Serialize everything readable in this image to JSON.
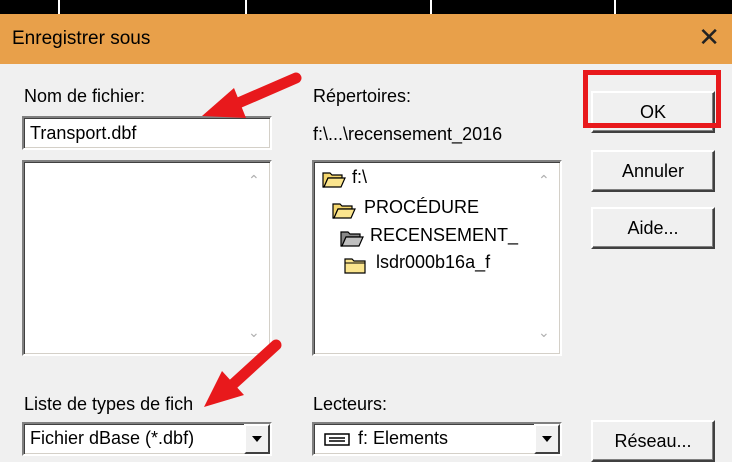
{
  "window": {
    "title": "Enregistrer sous",
    "close_glyph": "✕"
  },
  "file_name": {
    "label": "Nom de fichier:",
    "value": "Transport.dbf"
  },
  "directories": {
    "label": "Répertoires:",
    "current_path": "f:\\...\\recensement_2016",
    "items": [
      "f:\\",
      "PROCÉDURE",
      "RECENSEMENT_",
      "lsdr000b16a_f"
    ]
  },
  "file_types": {
    "label": "Liste de types de fich",
    "value": "Fichier dBase (*.dbf)"
  },
  "drives": {
    "label": "Lecteurs:",
    "value": "f: Elements"
  },
  "buttons": {
    "ok": "OK",
    "cancel": "Annuler",
    "help": "Aide...",
    "network": "Réseau..."
  },
  "annotation_color": "#e8191c"
}
